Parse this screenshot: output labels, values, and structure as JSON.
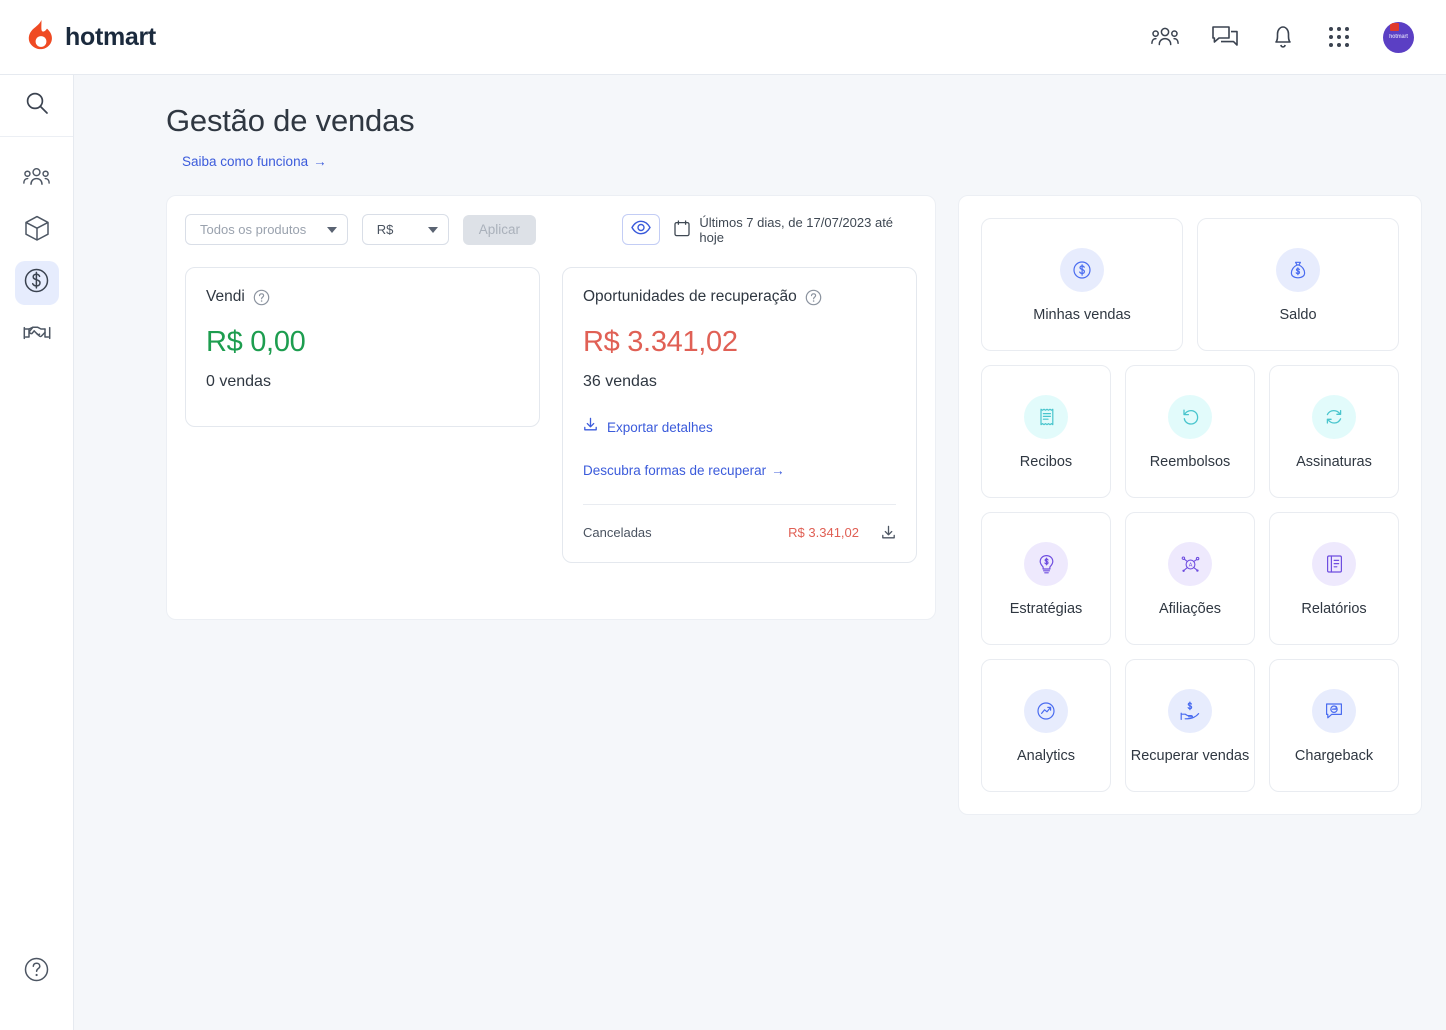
{
  "header": {
    "brand_name": "hotmart",
    "icons": [
      {
        "name": "community-icon",
        "label": "Comunidade"
      },
      {
        "name": "chat-icon",
        "label": "Mensagens"
      },
      {
        "name": "bell-icon",
        "label": "Notificações"
      },
      {
        "name": "apps-grid-icon",
        "label": "Aplicativos"
      }
    ],
    "avatar_text": "hotmart"
  },
  "sidebar": {
    "search_label": "Buscar",
    "items": [
      {
        "name": "sidebar-item-community",
        "label": "Comunidade",
        "active": false
      },
      {
        "name": "sidebar-item-products",
        "label": "Produtos",
        "active": false
      },
      {
        "name": "sidebar-item-sales",
        "label": "Vendas",
        "active": true
      },
      {
        "name": "sidebar-item-affiliates",
        "label": "Afiliações",
        "active": false
      }
    ],
    "help_label": "Ajuda"
  },
  "page": {
    "title": "Gestão de vendas",
    "how_it_works_link": "Saiba como funciona",
    "arrow": "→"
  },
  "filters": {
    "product_select_value": "Todos os produtos",
    "currency_select_value": "R$",
    "apply_button": "Aplicar",
    "eye_button_label": "Exibir valores",
    "date_range": "Últimos 7 dias, de 17/07/2023 até hoje"
  },
  "metrics": {
    "sold": {
      "title": "Vendi",
      "value": "R$ 0,00",
      "sales_count": "0 vendas"
    },
    "recovery": {
      "title": "Oportunidades de recuperação",
      "value": "R$ 3.341,02",
      "sales_count": "36 vendas",
      "export_link": "Exportar detalhes",
      "discover_link": "Descubra formas de recuperar",
      "arrow": "→",
      "breakdown": [
        {
          "label": "Canceladas",
          "value": "R$ 3.341,02"
        }
      ]
    }
  },
  "shortcuts": {
    "top": [
      {
        "name": "tile-minhas-vendas",
        "label": "Minhas vendas",
        "icon": "dollar-circle-icon",
        "tone": "blue"
      },
      {
        "name": "tile-saldo",
        "label": "Saldo",
        "icon": "money-bag-icon",
        "tone": "blue"
      }
    ],
    "grid": [
      {
        "name": "tile-recibos",
        "label": "Recibos",
        "icon": "receipt-icon",
        "tone": "teal"
      },
      {
        "name": "tile-reembolsos",
        "label": "Reembolsos",
        "icon": "undo-arrow-icon",
        "tone": "teal"
      },
      {
        "name": "tile-assinaturas",
        "label": "Assinaturas",
        "icon": "repeat-arrows-icon",
        "tone": "teal"
      },
      {
        "name": "tile-estrategias",
        "label": "Estratégias",
        "icon": "lightbulb-dollar-icon",
        "tone": "purple"
      },
      {
        "name": "tile-afiliacoes",
        "label": "Afiliações",
        "icon": "affiliate-network-icon",
        "tone": "purple"
      },
      {
        "name": "tile-relatorios",
        "label": "Relatórios",
        "icon": "book-report-icon",
        "tone": "purple"
      },
      {
        "name": "tile-analytics",
        "label": "Analytics",
        "icon": "analytics-trend-icon",
        "tone": "blue"
      },
      {
        "name": "tile-recuperar-vendas",
        "label": "Recuperar vendas",
        "icon": "hand-money-icon",
        "tone": "blue"
      },
      {
        "name": "tile-chargeback",
        "label": "Chargeback",
        "icon": "chargeback-chat-icon",
        "tone": "blue"
      }
    ]
  },
  "colors": {
    "brand_flame": "#ef4a23",
    "brand_text": "#1b2a3d",
    "link_blue": "#3b5bdb",
    "positive_green": "#1d9d4f",
    "negative_red": "#e06055",
    "tile_blue": "#4a6cf0",
    "tile_teal": "#49c5cd",
    "tile_purple": "#6f4ee0",
    "page_bg": "#f5f7fa"
  }
}
